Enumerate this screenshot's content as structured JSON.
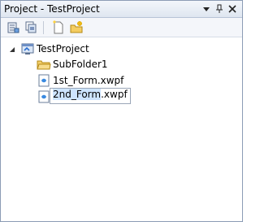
{
  "window": {
    "title": "Project - TestProject"
  },
  "titlebar_buttons": [
    {
      "name": "dropdown-icon"
    },
    {
      "name": "pin-icon"
    },
    {
      "name": "close-icon"
    }
  ],
  "toolbar": [
    {
      "name": "properties-icon"
    },
    {
      "name": "show-all-files-icon"
    },
    {
      "name": "new-item-icon"
    },
    {
      "name": "new-folder-icon"
    }
  ],
  "tree": {
    "root": {
      "label": "TestProject",
      "expanded": true
    },
    "items": [
      {
        "label": "SubFolder1",
        "type": "folder"
      },
      {
        "label": "1st_Form.xwpf",
        "type": "file"
      }
    ],
    "editing": {
      "selected_part": "2nd_Form",
      "rest": ".xwpf"
    }
  },
  "colors": {
    "titlebar": "#dfe6f0",
    "selection": "#cde4ff",
    "border": "#8c9cb5"
  }
}
